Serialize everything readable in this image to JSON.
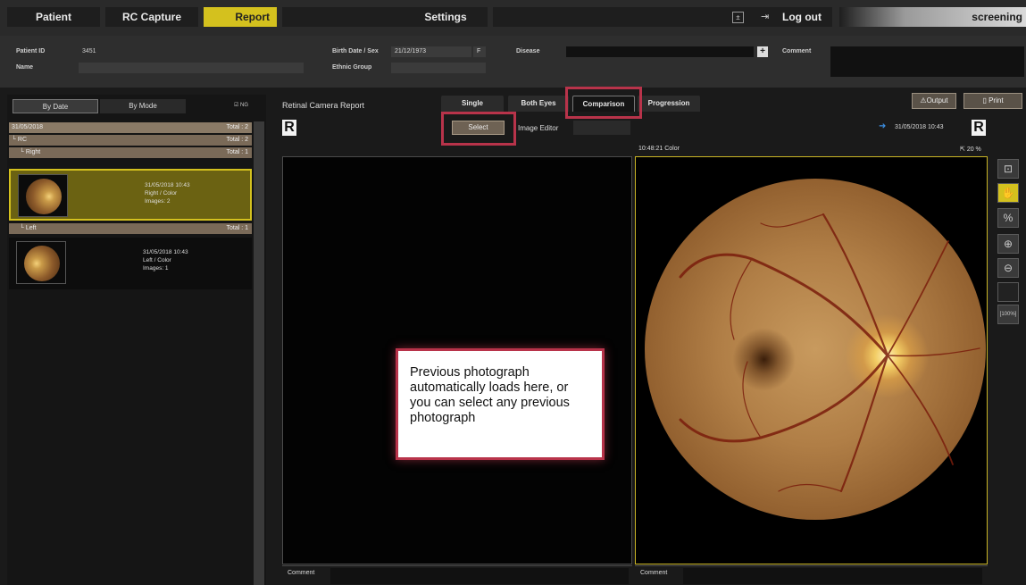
{
  "menu": {
    "patient": "Patient",
    "rc_capture": "RC Capture",
    "report": "Report",
    "settings": "Settings",
    "logout": "Log out",
    "screening": "screening"
  },
  "patient": {
    "id_label": "Patient ID",
    "id_value": "3451",
    "name_label": "Name",
    "name_value": "",
    "birth_label": "Birth Date / Sex",
    "birth_value": "21/12/1973",
    "sex_value": "F",
    "ethnic_label": "Ethnic Group",
    "disease_label": "Disease",
    "comment_label": "Comment"
  },
  "left_panel": {
    "tab_by_date": "By Date",
    "tab_by_mode": "By Mode",
    "ng_label": "NG",
    "date_row": {
      "label": "31/05/2018",
      "total": "Total : 2"
    },
    "rc_row": {
      "label": "RC",
      "total": "Total : 2"
    },
    "right_row": {
      "label": "Right",
      "total": "Total : 1"
    },
    "right_item": {
      "line1": "31/05/2018 10:43",
      "line2": "Right / Color",
      "line3": "Images: 2"
    },
    "left_row": {
      "label": "Left",
      "total": "Total : 1"
    },
    "left_item": {
      "line1": "31/05/2018 10:43",
      "line2": "Left / Color",
      "line3": "Images: 1"
    }
  },
  "report": {
    "title": "Retinal Camera Report",
    "tabs": [
      "Single",
      "Both Eyes",
      "Comparison",
      "Progression"
    ],
    "active_tab": "Comparison",
    "output_label": "Output",
    "print_label": "Print",
    "eye_letter": "R",
    "select_label": "Select",
    "image_editor_label": "Image Editor",
    "right_date": "31/05/2018 10:43",
    "right_caption": "10:48:21 Color",
    "right_zoom": "20 %",
    "comment_label": "Comment"
  },
  "callout": {
    "text": "Previous photograph automatically loads here, or you can select any previous photograph"
  },
  "colors": {
    "accent_yellow": "#d4c11e",
    "highlight_red": "#b8334a"
  },
  "side_tools": [
    "magnifier-icon",
    "hand-icon",
    "percent-icon",
    "zoom-in-icon",
    "zoom-out-icon",
    "blank-tool",
    "fit-100-icon"
  ]
}
